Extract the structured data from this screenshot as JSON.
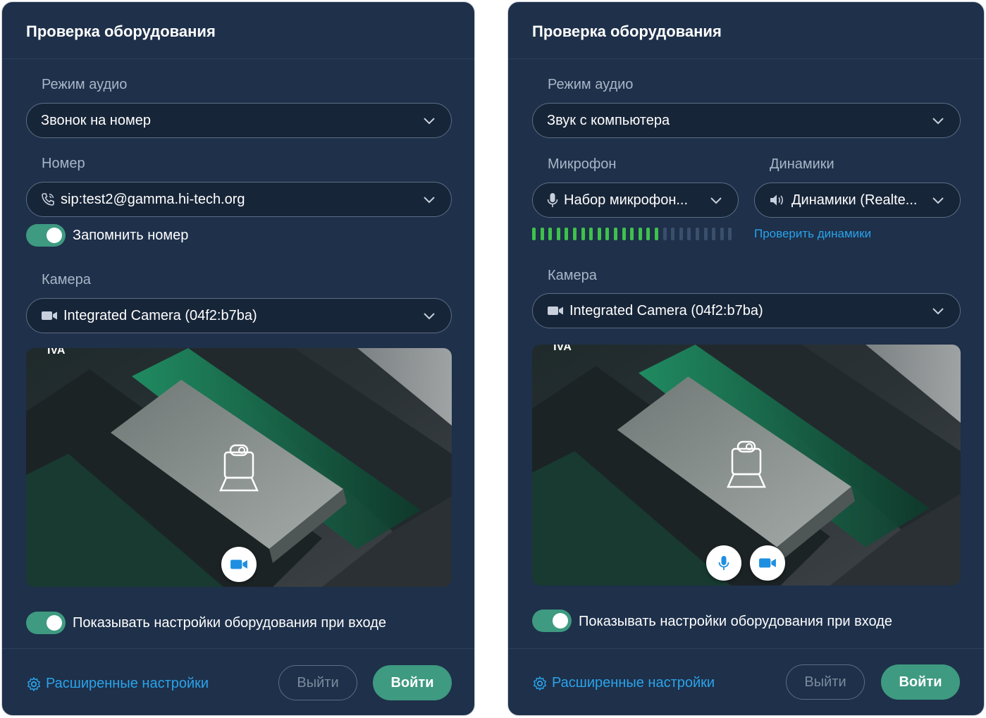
{
  "colors": {
    "panel_bg": "#1e304a",
    "field_bg": "#172538",
    "accent_green": "#3e9a80",
    "link_blue": "#2aa3ea",
    "meter_active": "#3ec24b",
    "meter_inactive": "#3a4f6b"
  },
  "left_panel": {
    "title": "Проверка оборудования",
    "audio_mode_label": "Режим аудио",
    "audio_mode_value": "Звонок на номер",
    "number_label": "Номер",
    "number_value": "sip:test2@gamma.hi-tech.org",
    "number_icon": "phone-icon",
    "remember_label": "Запомнить номер",
    "remember_on": true,
    "camera_label": "Камера",
    "camera_value": "Integrated Camera (04f2:b7ba)",
    "camera_icon": "video-camera-icon",
    "show_settings_label": "Показывать настройки оборудования при входе",
    "show_settings_on": true,
    "advanced_label": "Расширенные настройки",
    "exit_label": "Выйти",
    "enter_label": "Войти"
  },
  "right_panel": {
    "title": "Проверка оборудования",
    "audio_mode_label": "Режим аудио",
    "audio_mode_value": "Звук с компьютера",
    "mic_label": "Микрофон",
    "mic_value": "Набор микрофон...",
    "mic_icon": "microphone-icon",
    "speakers_label": "Динамики",
    "speakers_value": "Динамики (Realte...",
    "speakers_icon": "speaker-icon",
    "mic_level": {
      "active_bars": 16,
      "total_bars": 25
    },
    "check_speakers_label": "Проверить динамики",
    "camera_label": "Камера",
    "camera_value": "Integrated Camera (04f2:b7ba)",
    "camera_icon": "video-camera-icon",
    "show_settings_label": "Показывать настройки оборудования при входе",
    "show_settings_on": true,
    "advanced_label": "Расширенные настройки",
    "exit_label": "Выйти",
    "enter_label": "Войти"
  }
}
